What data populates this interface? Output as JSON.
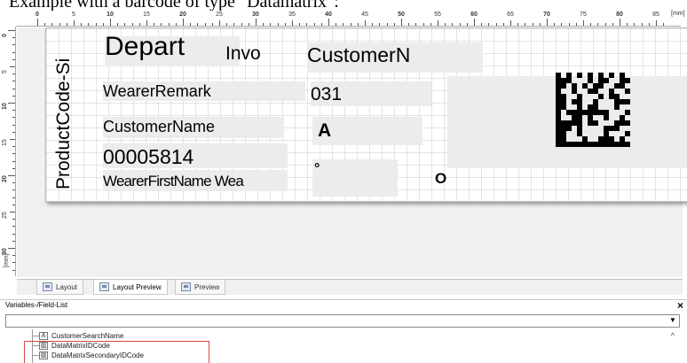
{
  "caption": "Example with a barcode of type \"Datamatrix\":",
  "ruler": {
    "unit": "[mm]",
    "top_labels": [
      "0",
      "5",
      "10",
      "15",
      "20",
      "25",
      "30",
      "35",
      "40",
      "45",
      "50",
      "55",
      "60",
      "65",
      "70",
      "75",
      "80",
      "85"
    ],
    "left_labels": [
      "0",
      "5",
      "10",
      "15",
      "20",
      "25",
      "30"
    ]
  },
  "label": {
    "product_code": "ProductCode-Si",
    "department": "Depart",
    "invoice": "Invo",
    "customer_number": "CustomerN",
    "wearer_remark": "WearerRemark",
    "size_code": "031",
    "customer_name": "CustomerName",
    "letter_a": "A",
    "number": "00005814",
    "wearer_first_name": "WearerFirstName Wea",
    "degree": "°",
    "letter_o": "O"
  },
  "tabs": [
    "Layout",
    "Layout Preview",
    "Preview"
  ],
  "panel": {
    "title": "Variables-/Field-List",
    "close_glyph": "×",
    "dropdown_glyph": "▼"
  },
  "tree": {
    "scroll_glyph": "^",
    "items": [
      {
        "icon": "A",
        "label": "CustomerSearchName"
      },
      {
        "icon": "▥",
        "label": "DataMatrixIDCode"
      },
      {
        "icon": "▥",
        "label": "DataMatrixSecondaryIDCode"
      }
    ]
  }
}
